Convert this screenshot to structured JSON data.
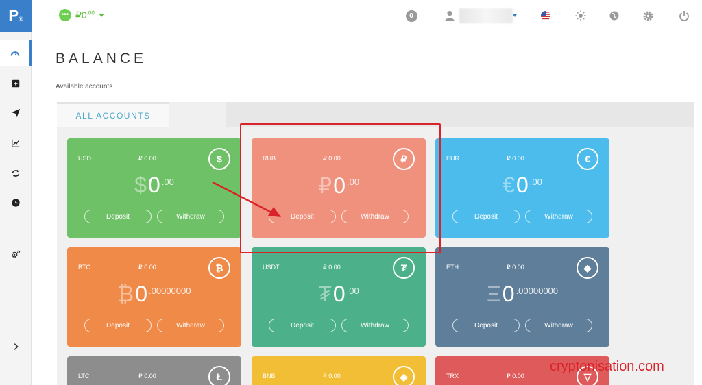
{
  "logo": {
    "letter": "P",
    "sub": "®"
  },
  "wallet": {
    "icon": "ellipsis-icon",
    "dots": "•••",
    "amount": "₽0",
    "decimals": ".00"
  },
  "topbar": {
    "notification_count": "0"
  },
  "page": {
    "title": "BALANCE",
    "subtitle": "Available accounts"
  },
  "tabs": [
    {
      "label": "ALL ACCOUNTS"
    }
  ],
  "cards": [
    {
      "currency": "USD",
      "small_balance": "₽ 0.00",
      "symbol": "$",
      "icon_glyph": "$",
      "integer": "0",
      "decimals": ".00",
      "deposit": "Deposit",
      "withdraw": "Withdraw",
      "color": "#6ec166"
    },
    {
      "currency": "RUB",
      "small_balance": "₽ 0.00",
      "symbol": "₽",
      "icon_glyph": "₽",
      "integer": "0",
      "decimals": ".00",
      "deposit": "Deposit",
      "withdraw": "Withdraw",
      "color": "#ef917c"
    },
    {
      "currency": "EUR",
      "small_balance": "₽ 0.00",
      "symbol": "€",
      "icon_glyph": "€",
      "integer": "0",
      "decimals": ".00",
      "deposit": "Deposit",
      "withdraw": "Withdraw",
      "color": "#4cbcec"
    },
    {
      "currency": "BTC",
      "small_balance": "₽ 0.00",
      "symbol": "₿",
      "icon_glyph": "₿",
      "integer": "0",
      "decimals": ".00000000",
      "deposit": "Deposit",
      "withdraw": "Withdraw",
      "color": "#ef8a49"
    },
    {
      "currency": "USDT",
      "small_balance": "₽ 0.00",
      "symbol": "₮",
      "icon_glyph": "₮",
      "integer": "0",
      "decimals": ".00",
      "deposit": "Deposit",
      "withdraw": "Withdraw",
      "color": "#4cb08a"
    },
    {
      "currency": "ETH",
      "small_balance": "₽ 0.00",
      "symbol": "Ξ",
      "icon_glyph": "◆",
      "integer": "0",
      "decimals": ".00000000",
      "deposit": "Deposit",
      "withdraw": "Withdraw",
      "color": "#5e7e99"
    },
    {
      "currency": "LTC",
      "small_balance": "₽ 0.00",
      "icon_glyph": "Ł",
      "color": "#8d8d8d"
    },
    {
      "currency": "BNB",
      "small_balance": "₽ 0.00",
      "icon_glyph": "◈",
      "color": "#f2be35"
    },
    {
      "currency": "TRX",
      "small_balance": "₽ 0.00",
      "icon_glyph": "▽",
      "color": "#df5a5a"
    }
  ],
  "watermark": "cryptonisation.com",
  "colors": {
    "accent": "#3a7fc9",
    "wallet_green": "#5bbf3c",
    "highlight_red": "#d9232b"
  }
}
